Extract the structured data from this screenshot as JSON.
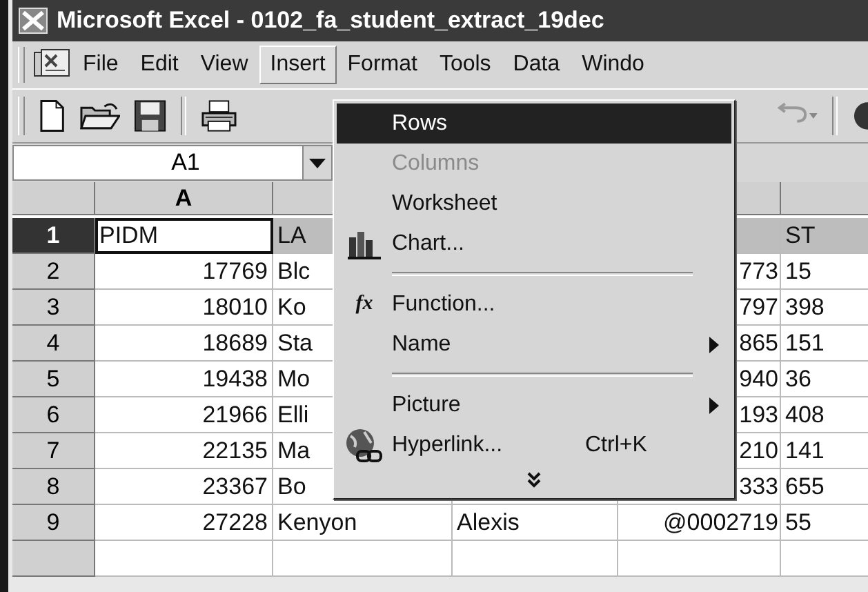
{
  "window": {
    "title": "Microsoft Excel - 0102_fa_student_extract_19dec"
  },
  "menu_bar": [
    {
      "label": "File",
      "selected": false
    },
    {
      "label": "Edit",
      "selected": false
    },
    {
      "label": "View",
      "selected": false
    },
    {
      "label": "Insert",
      "selected": true
    },
    {
      "label": "Format",
      "selected": false
    },
    {
      "label": "Tools",
      "selected": false
    },
    {
      "label": "Data",
      "selected": false
    },
    {
      "label": "Windo",
      "selected": false
    }
  ],
  "name_box": "A1",
  "sheet": {
    "columns": [
      {
        "label": "A",
        "selected": true
      }
    ],
    "rows": [
      {
        "label": "1",
        "kind": "header",
        "selected": true,
        "cells": [
          "PIDM",
          "LA",
          null,
          null,
          "ST"
        ]
      },
      {
        "label": "2",
        "kind": "data",
        "selected": false,
        "cells": [
          "17769",
          "Blc",
          null,
          "773",
          "15"
        ]
      },
      {
        "label": "3",
        "kind": "data",
        "selected": false,
        "cells": [
          "18010",
          "Ko",
          null,
          "797",
          "398"
        ]
      },
      {
        "label": "4",
        "kind": "data",
        "selected": false,
        "cells": [
          "18689",
          "Sta",
          null,
          "865",
          "151"
        ]
      },
      {
        "label": "5",
        "kind": "data",
        "selected": false,
        "cells": [
          "19438",
          "Mo",
          null,
          "940",
          "36"
        ]
      },
      {
        "label": "6",
        "kind": "data",
        "selected": false,
        "cells": [
          "21966",
          "Elli",
          null,
          "193",
          "408"
        ]
      },
      {
        "label": "7",
        "kind": "data",
        "selected": false,
        "cells": [
          "22135",
          "Ma",
          null,
          "210",
          "141"
        ]
      },
      {
        "label": "8",
        "kind": "data",
        "selected": false,
        "cells": [
          "23367",
          "Bo",
          null,
          "333",
          "655"
        ]
      },
      {
        "label": "9",
        "kind": "data",
        "selected": false,
        "cells": [
          "27228",
          "Kenyon",
          "Alexis",
          "@0002719",
          "55"
        ]
      }
    ]
  },
  "insert_menu": {
    "items": [
      {
        "kind": "item",
        "label": "Rows",
        "selected": true,
        "disabled": false
      },
      {
        "kind": "item",
        "label": "Columns",
        "selected": false,
        "disabled": true
      },
      {
        "kind": "item",
        "label": "Worksheet",
        "selected": false,
        "disabled": false
      },
      {
        "kind": "item",
        "label": "Chart...",
        "selected": false,
        "disabled": false
      },
      {
        "kind": "separator"
      },
      {
        "kind": "item",
        "label": "Function...",
        "glyph": "fx",
        "selected": false,
        "disabled": false
      },
      {
        "kind": "item",
        "label": "Name",
        "submenu": true,
        "selected": false,
        "disabled": false
      },
      {
        "kind": "separator"
      },
      {
        "kind": "item",
        "label": "Picture",
        "submenu": true,
        "selected": false,
        "disabled": false
      },
      {
        "kind": "item",
        "label": "Hyperlink...",
        "shortcut": "Ctrl+K",
        "selected": false,
        "disabled": false
      },
      {
        "kind": "expand"
      }
    ]
  }
}
